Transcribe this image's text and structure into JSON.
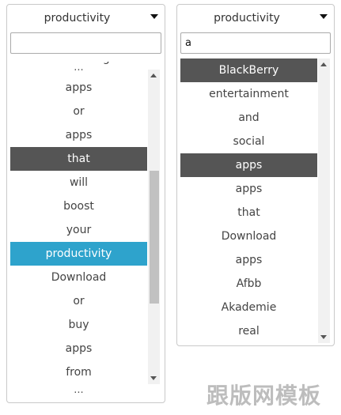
{
  "left_select": {
    "selected_value": "productivity",
    "search_value": "",
    "options_top_partial": "networking",
    "ellipsis_top": "...",
    "ellipsis_bottom": "...",
    "options": [
      {
        "label": "apps"
      },
      {
        "label": "or"
      },
      {
        "label": "apps"
      },
      {
        "label": "that",
        "state": "highlighted"
      },
      {
        "label": "will"
      },
      {
        "label": "boost"
      },
      {
        "label": "your"
      },
      {
        "label": "productivity",
        "state": "selected"
      },
      {
        "label": "Download"
      },
      {
        "label": "or"
      },
      {
        "label": "buy"
      },
      {
        "label": "apps"
      },
      {
        "label": "from"
      }
    ]
  },
  "right_select": {
    "selected_value": "productivity",
    "search_value": "a",
    "options": [
      {
        "label": "BlackBerry",
        "state": "highlighted"
      },
      {
        "label": "entertainment"
      },
      {
        "label": "and"
      },
      {
        "label": "social"
      },
      {
        "label": "apps",
        "state": "highlighted"
      },
      {
        "label": "apps"
      },
      {
        "label": "that"
      },
      {
        "label": "Download"
      },
      {
        "label": "apps"
      },
      {
        "label": "Afbb"
      },
      {
        "label": "Akademie"
      },
      {
        "label": "real"
      }
    ]
  },
  "colors": {
    "highlight_grey": "#555555",
    "selected_blue": "#2ea3cc",
    "border": "#c9c9c9"
  },
  "watermark": "跟版网模板"
}
